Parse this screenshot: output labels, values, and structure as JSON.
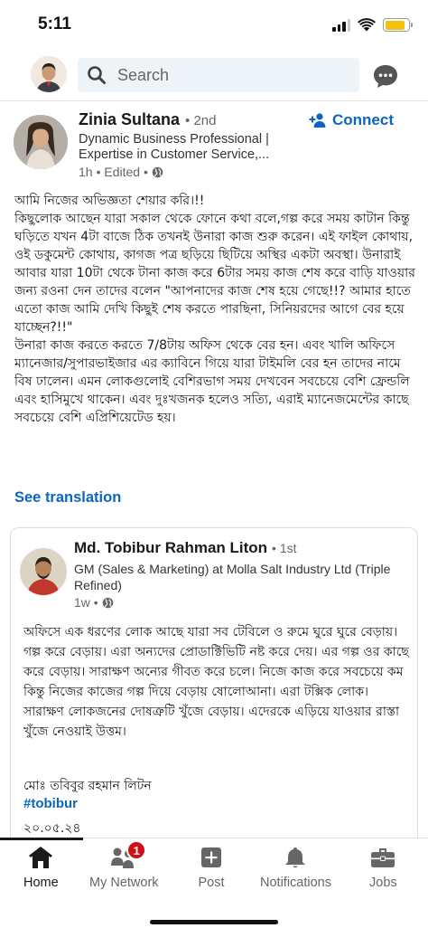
{
  "status_bar": {
    "time": "5:11",
    "battery_level": 0.85,
    "battery_color": "#f4c20d"
  },
  "top_nav": {
    "search_placeholder": "Search",
    "icons": {
      "search": "search-icon",
      "messaging": "messaging-icon"
    }
  },
  "post": {
    "author": {
      "name": "Zinia Sultana",
      "degree": "• 2nd",
      "headline": "Dynamic Business Professional | Expertise in Customer Service,...",
      "time": "1h",
      "edited": "• Edited •"
    },
    "connect_label": "Connect",
    "body": [
      "আমি নিজের অভিজ্ঞতা শেয়ার করি।!!",
      "কিছুলোক আছেন যারা সকাল থেকে ফোনে কথা বলে,গল্প করে সময় কাটান কিন্তু ঘড়িতে যখন 4টা বাজে ঠিক তখনই উনারা কাজ শুরু করেন। এই ফাইল কোথায়, ওই ডকুমেন্ট কোথায়, কাগজ পত্র ছড়িয়ে ছিটিয়ে অস্থির একটা অবস্থা। উনারাই আবার যারা 10টা থেকে টানা কাজ করে 6টার সময় কাজ শেষ করে বাড়ি যাওয়ার জন্য রওনা দেন তাদের বলেন \"আপনাদের কাজ শেষ হয়ে গেছে!!? আমার হাতে এতো কাজ আমি দেখি কিছুই শেষ করতে পারছিনা, সিনিয়রদের আগে বের হয়ে যাচ্ছেন?!!\"",
      "উনারা কাজ করতে করতে 7/8টায় অফিস থেকে বের হন। এবং খালি অফিসে ম্যানেজার/সুপারভাইজার এর ক্যাবিনে গিয়ে যারা টাইমলি বের হন তাদের নামে বিষ ঢালেন। এমন লোকগুলোই বেশিরভাগ সময় দেখবেন সবচেয়ে বেশি ফ্রেন্ডলি এবং হাসিমুখে থাকেন। এবং দুঃখজনক হলেও সত্যি, এরাই ম্যানেজমেন্টের কাছে সবচেয়ে বেশি এপ্রিশিয়েটেড হয়।"
    ],
    "see_translation": "See translation"
  },
  "reshared": {
    "author": {
      "name": "Md. Tobibur Rahman Liton",
      "degree": "• 1st",
      "headline": "GM (Sales & Marketing) at Molla Salt Industry Ltd (Triple Refined)",
      "time": "1w •"
    },
    "body": "অফিসে এক ধরণের লোক আছে যারা সব টেবিলে ও রুমে ঘুরে ঘুরে বেড়ায়। গল্প করে বেড়ায়। এরা অন্যদের প্রোডাক্টিভিটি নষ্ট করে দেয়। এর গল্প ওর কাছে করে বেড়ায়। সারাক্ষণ অন্যের গীবত করে চলে। নিজে কাজ করে সবচেয়ে কম কিন্তু নিজের কাজের গল্প দিয়ে বেড়ায় ষোলোআনা। এরা টক্সিক লোক। সারাক্ষণ লোকজনের দোষত্রুটি খুঁজে বেড়ায়। এদেরকে এড়িয়ে যাওয়ার রাস্তা খুঁজে নেওয়াই উত্তম।",
    "signature": "মোঃ তবিবুর রহমান লিটন",
    "hashtag": "#tobibur",
    "date": "২০.০৫.২৪"
  },
  "bottom_nav": {
    "items": [
      {
        "label": "Home",
        "icon": "home-icon",
        "active": true
      },
      {
        "label": "My Network",
        "icon": "network-icon",
        "badge": "1"
      },
      {
        "label": "Post",
        "icon": "post-icon"
      },
      {
        "label": "Notifications",
        "icon": "bell-icon"
      },
      {
        "label": "Jobs",
        "icon": "briefcase-icon"
      }
    ]
  },
  "colors": {
    "accent": "#0a66c2",
    "badge": "#cc1016",
    "search_bg": "#eef3f8"
  }
}
